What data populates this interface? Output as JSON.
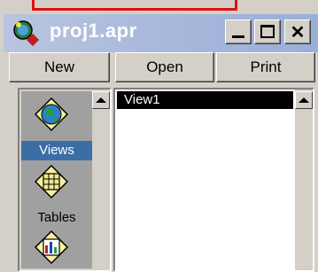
{
  "window": {
    "title": "proj1.apr",
    "min_label": "_",
    "restore_label": "☐",
    "close_label": "✕"
  },
  "toolbar": {
    "new_label": "New",
    "open_label": "Open",
    "print_label": "Print"
  },
  "sidebar": {
    "items": [
      {
        "label": "Views",
        "icon": "globe-icon",
        "selected": true
      },
      {
        "label": "Tables",
        "icon": "table-icon",
        "selected": false
      },
      {
        "label": "",
        "icon": "chart-icon",
        "selected": false
      }
    ]
  },
  "list": {
    "items": [
      "View1"
    ]
  },
  "colors": {
    "titlebar": "#9aaed8",
    "selection": "#000000",
    "sidebar_selected": "#3a6ea5",
    "frame_accent": "#e01010"
  }
}
